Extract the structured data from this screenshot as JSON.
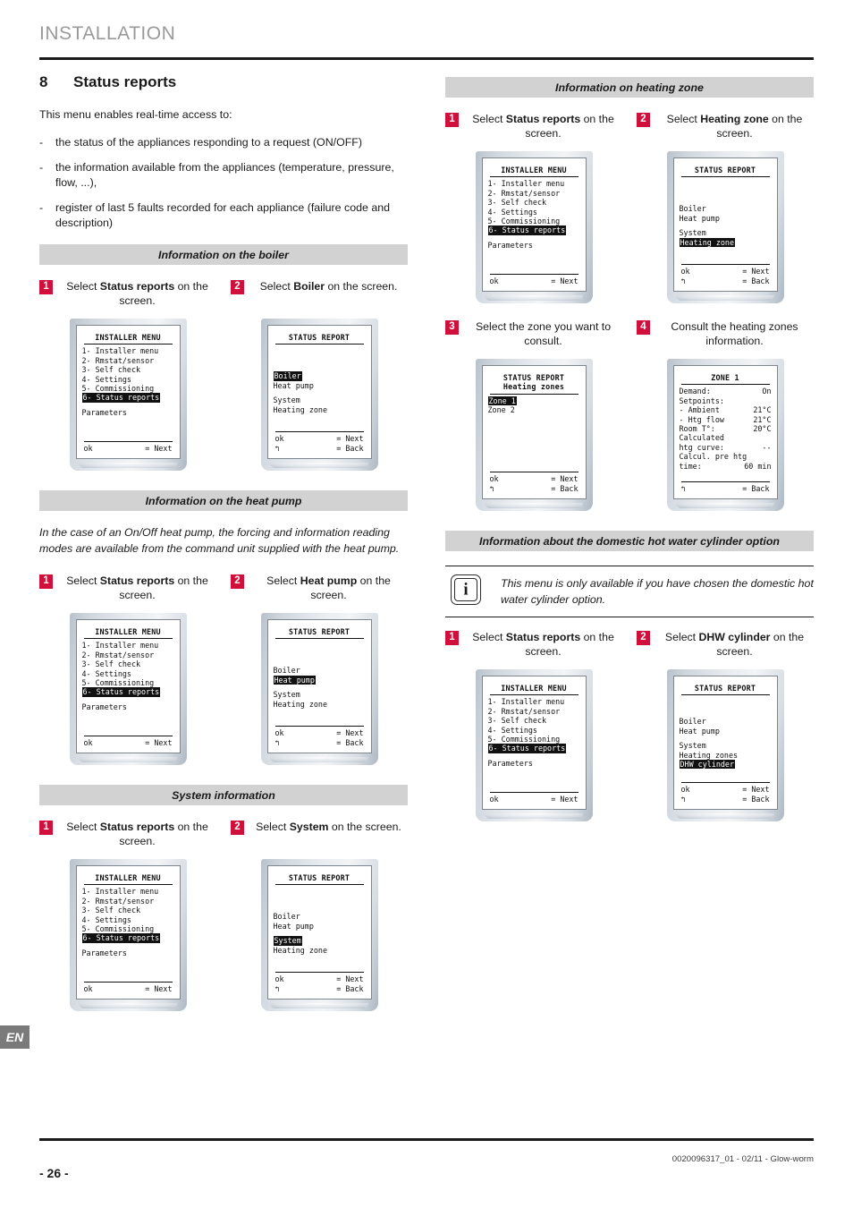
{
  "header": {
    "title": "INSTALLATION"
  },
  "chapter": {
    "number": "8",
    "title": "Status reports"
  },
  "intro": "This menu enables real-time access to:",
  "bullets": [
    {
      "dash": "-",
      "text": "the status of the appliances responding to a request (ON/OFF)"
    },
    {
      "dash": "-",
      "text": "the information available from the appliances (temperature, pressure, flow, ...),"
    },
    {
      "dash": "-",
      "text": "register of last 5 faults recorded for each appliance (failure code and description)"
    }
  ],
  "sections": {
    "boiler": {
      "bar": "Information on the boiler"
    },
    "heat_pump": {
      "bar": "Information on the heat pump",
      "note": "In the case of an On/Off heat pump, the forcing and information reading modes are available from the command unit supplied with the heat pump."
    },
    "system": {
      "bar": "System information"
    },
    "heating_zone": {
      "bar": "Information on heating zone"
    },
    "dhw": {
      "bar": "Information about the domestic hot water cylinder option",
      "callout": "This menu is only available if you have chosen the domestic hot water cylinder option.",
      "callout_icon": "info-icon"
    }
  },
  "steps": {
    "status_reports": {
      "num": "1",
      "pre": "Select ",
      "bold": "Status reports",
      "post": " on the screen."
    },
    "boiler": {
      "num": "2",
      "pre": "Select ",
      "bold": "Boiler",
      "post": " on the screen."
    },
    "heat_pump": {
      "num": "2",
      "pre": "Select ",
      "bold": "Heat pump",
      "post": " on the screen."
    },
    "system": {
      "num": "2",
      "pre": "Select ",
      "bold": "System",
      "post": " on the screen."
    },
    "heating_zone": {
      "num": "2",
      "pre": "Select ",
      "bold": "Heating zone",
      "post": " on the screen."
    },
    "zone_select": {
      "num": "3",
      "pre": "Select the zone you want to consult.",
      "bold": "",
      "post": ""
    },
    "zone_consult": {
      "num": "4",
      "pre": "Consult the heating zones information.",
      "bold": "",
      "post": ""
    },
    "dhw": {
      "num": "2",
      "pre": "Select ",
      "bold": "DHW cylinder",
      "post": " on the screen."
    }
  },
  "screens": {
    "installer_menu": {
      "title": "INSTALLER MENU",
      "lines": [
        "1- Installer menu",
        "2- Rmstat/sensor",
        "3- Self check",
        "4- Settings",
        "5- Commissioning",
        "6- Status reports"
      ],
      "highlight": "6- Status reports",
      "extra": "Parameters",
      "foot": [
        {
          "key": "ok",
          "val": "= Next"
        }
      ]
    },
    "status_report_boiler": {
      "title": "STATUS REPORT",
      "lines": [
        "Boiler",
        "Heat pump",
        "System",
        "Heating zone"
      ],
      "highlight": "Boiler",
      "foot": [
        {
          "key": "ok",
          "val": "= Next"
        },
        {
          "key": "↰",
          "val": "= Back"
        }
      ]
    },
    "status_report_heatpump": {
      "title": "STATUS REPORT",
      "lines": [
        "Boiler",
        "Heat pump",
        "System",
        "Heating zone"
      ],
      "highlight": "Heat pump",
      "foot": [
        {
          "key": "ok",
          "val": "= Next"
        },
        {
          "key": "↰",
          "val": "= Back"
        }
      ]
    },
    "status_report_system": {
      "title": "STATUS REPORT",
      "lines": [
        "Boiler",
        "Heat pump",
        "System",
        "Heating zone"
      ],
      "highlight": "System",
      "foot": [
        {
          "key": "ok",
          "val": "= Next"
        },
        {
          "key": "↰",
          "val": "= Back"
        }
      ]
    },
    "status_report_zone": {
      "title": "STATUS REPORT",
      "lines": [
        "Boiler",
        "Heat pump",
        "System",
        "Heating zone"
      ],
      "highlight": "Heating zone",
      "foot": [
        {
          "key": "ok",
          "val": "= Next"
        },
        {
          "key": "↰",
          "val": "= Back"
        }
      ]
    },
    "status_report_dhw": {
      "title": "STATUS REPORT",
      "lines": [
        "Boiler",
        "Heat pump",
        "System",
        "Heating zones",
        "DHW cylinder"
      ],
      "highlight": "DHW cylinder",
      "foot": [
        {
          "key": "ok",
          "val": "= Next"
        },
        {
          "key": "↰",
          "val": "= Back"
        }
      ]
    },
    "heating_zones_list": {
      "title": "STATUS REPORT",
      "subtitle": "Heating zones",
      "lines": [
        "Zone 1",
        "Zone 2"
      ],
      "highlight": "Zone 1",
      "foot": [
        {
          "key": "ok",
          "val": "= Next"
        },
        {
          "key": "↰",
          "val": "= Back"
        }
      ]
    },
    "zone1_detail": {
      "title": "ZONE 1",
      "rows": [
        {
          "label": "Demand:",
          "value": "On"
        },
        {
          "label": "Setpoints:",
          "value": ""
        },
        {
          "label": "- Ambient",
          "value": "21°C"
        },
        {
          "label": "- Htg flow",
          "value": "21°C"
        },
        {
          "label": "Room T°:",
          "value": "20°C"
        },
        {
          "label": "Calculated",
          "value": ""
        },
        {
          "label": "htg curve:",
          "value": "--"
        },
        {
          "label": "Calcul. pre htg",
          "value": ""
        },
        {
          "label": "time:",
          "value": "60 min"
        }
      ],
      "foot": [
        {
          "key": "↰",
          "val": "= Back"
        }
      ]
    }
  },
  "en_tab": "EN",
  "footer": {
    "code": "0020096317_01 - 02/11 - Glow-worm",
    "page": "- 26 -"
  }
}
